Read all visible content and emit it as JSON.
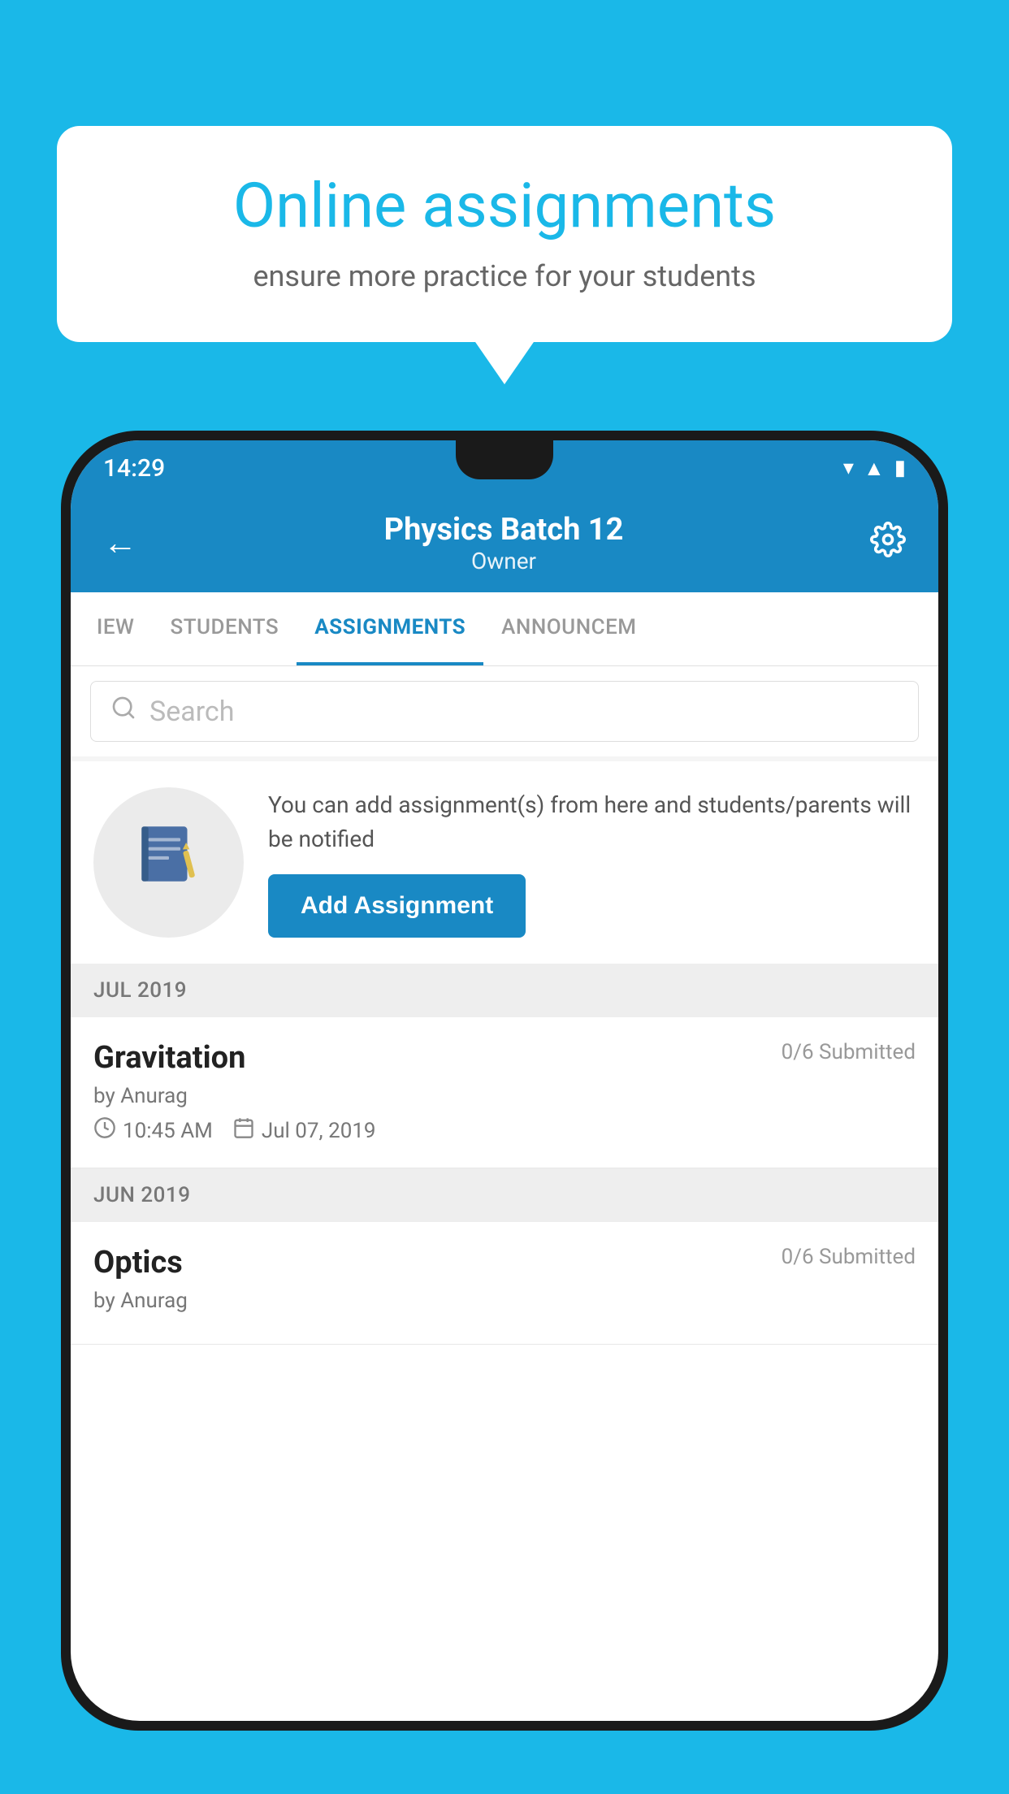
{
  "background_color": "#1ab8e8",
  "speech_bubble": {
    "title": "Online assignments",
    "subtitle": "ensure more practice for your students"
  },
  "phone": {
    "status_bar": {
      "time": "14:29",
      "icons": [
        "wifi",
        "signal",
        "battery"
      ]
    },
    "header": {
      "title": "Physics Batch 12",
      "subtitle": "Owner",
      "back_label": "←",
      "settings_label": "⚙"
    },
    "tabs": [
      {
        "label": "IEW",
        "active": false
      },
      {
        "label": "STUDENTS",
        "active": false
      },
      {
        "label": "ASSIGNMENTS",
        "active": true
      },
      {
        "label": "ANNOUNCEM",
        "active": false
      }
    ],
    "search": {
      "placeholder": "Search"
    },
    "promo": {
      "text": "You can add assignment(s) from here and students/parents will be notified",
      "button_label": "Add Assignment"
    },
    "sections": [
      {
        "month": "JUL 2019",
        "assignments": [
          {
            "name": "Gravitation",
            "submitted": "0/6 Submitted",
            "by": "by Anurag",
            "time": "10:45 AM",
            "date": "Jul 07, 2019"
          }
        ]
      },
      {
        "month": "JUN 2019",
        "assignments": [
          {
            "name": "Optics",
            "submitted": "0/6 Submitted",
            "by": "by Anurag",
            "time": "",
            "date": ""
          }
        ]
      }
    ]
  }
}
